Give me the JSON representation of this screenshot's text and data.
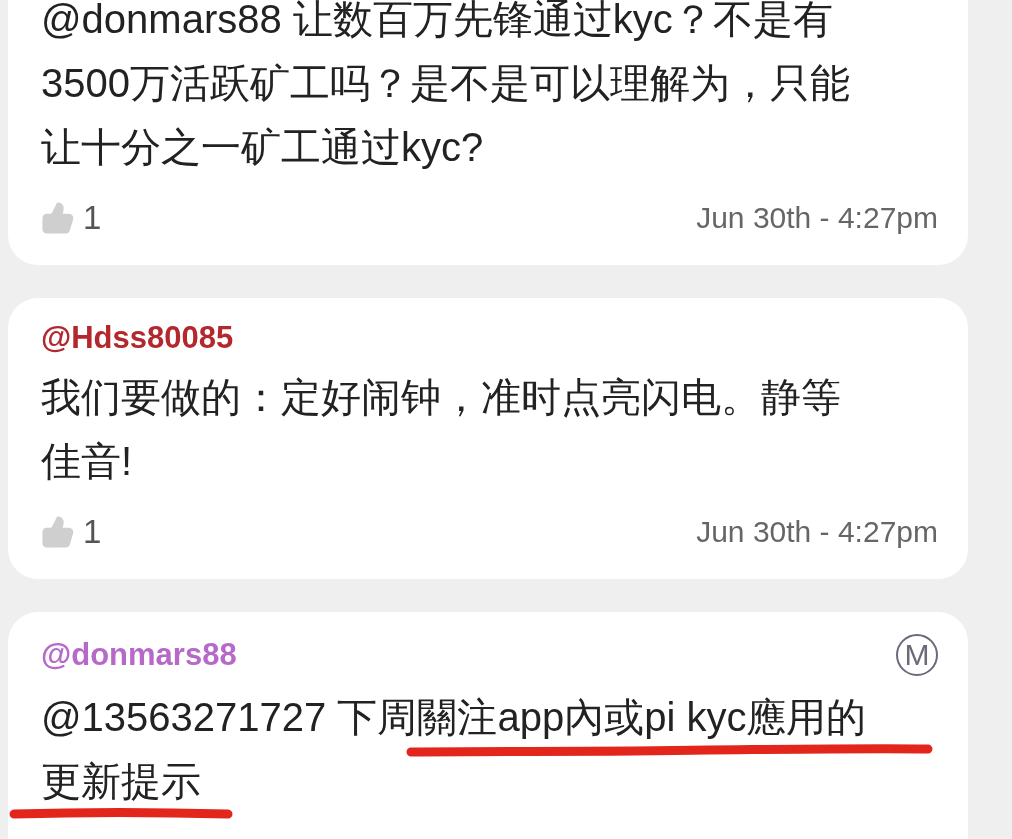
{
  "comments": [
    {
      "lines": [
        "@donmars88 让数百万先锋通过kyc？不是有",
        "3500万活跃矿工吗？是不是可以理解为，只能",
        "让十分之一矿工通过kyc?"
      ],
      "likes": "1",
      "time": "Jun 30th - 4:27pm"
    },
    {
      "author": "@Hdss80085",
      "color": "#b3282d",
      "lines": [
        "我们要做的：定好闹钟，准时点亮闪电。静等",
        "佳音!"
      ],
      "likes": "1",
      "time": "Jun 30th - 4:27pm"
    },
    {
      "author": "@donmars88",
      "color": "#b769c9",
      "badge": "M",
      "lines": [
        "@13563271727 下周關注app內或pi kyc應用的",
        "更新提示"
      ],
      "underlined": true
    }
  ]
}
